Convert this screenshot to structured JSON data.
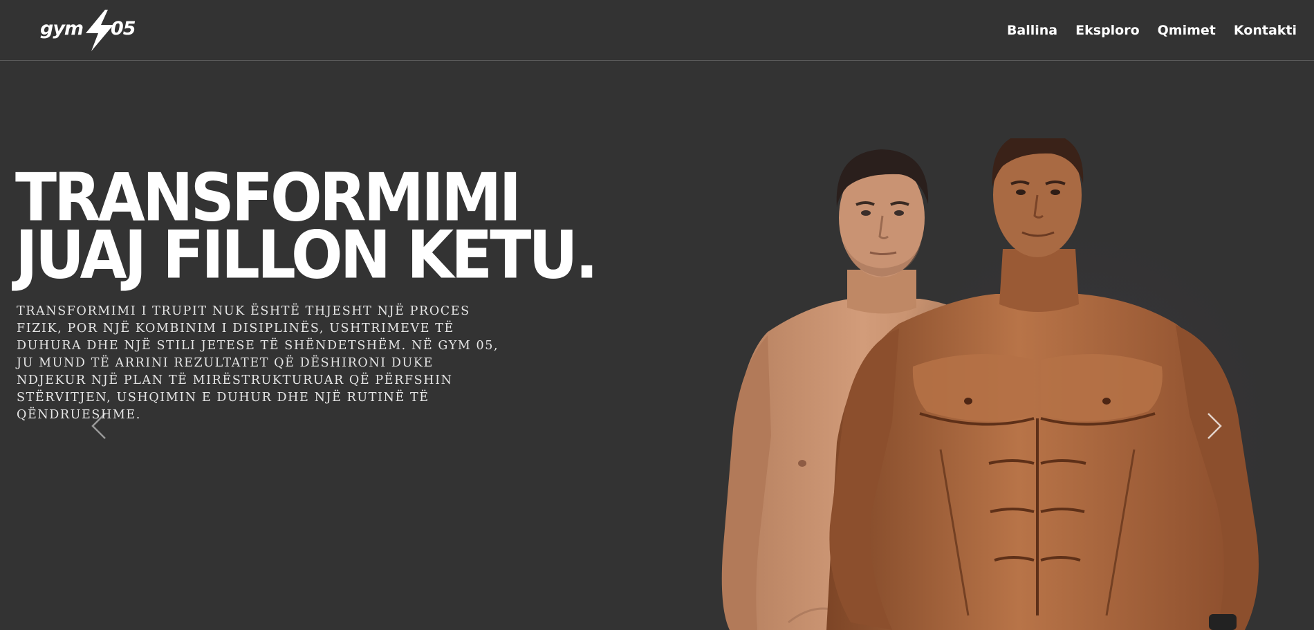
{
  "navbar": {
    "logo": {
      "left_text": "gym",
      "right_text": "05"
    },
    "links": [
      {
        "label": "Ballina"
      },
      {
        "label": "Eksploro"
      },
      {
        "label": "Qmimet"
      },
      {
        "label": "Kontakti"
      }
    ]
  },
  "hero": {
    "title_line1": "TRANSFORMIMI",
    "title_line2": "JUAJ FILLON KETU.",
    "description": "Transformimi i trupit nuk është thjesht një proces fizik, por një kombinim i disiplinës, ushtrimeve të duhura dhe një stili jetese të shëndetshëm. Në GYM 05, ju mund të arrini rezultatet që dëshironi duke ndjekur një plan të mirëstrukturuar që përfshin stërvitjen, ushqimin e duhur dhe një rutinë të qëndrueshme."
  },
  "carousel": {
    "prev_icon": "chevron-left-icon",
    "next_icon": "chevron-right-icon"
  },
  "colors": {
    "background": "#333333",
    "text": "#ffffff",
    "divider": "#5a5a5a",
    "skin_before": "#c8906c",
    "skin_after": "#a8653e"
  }
}
